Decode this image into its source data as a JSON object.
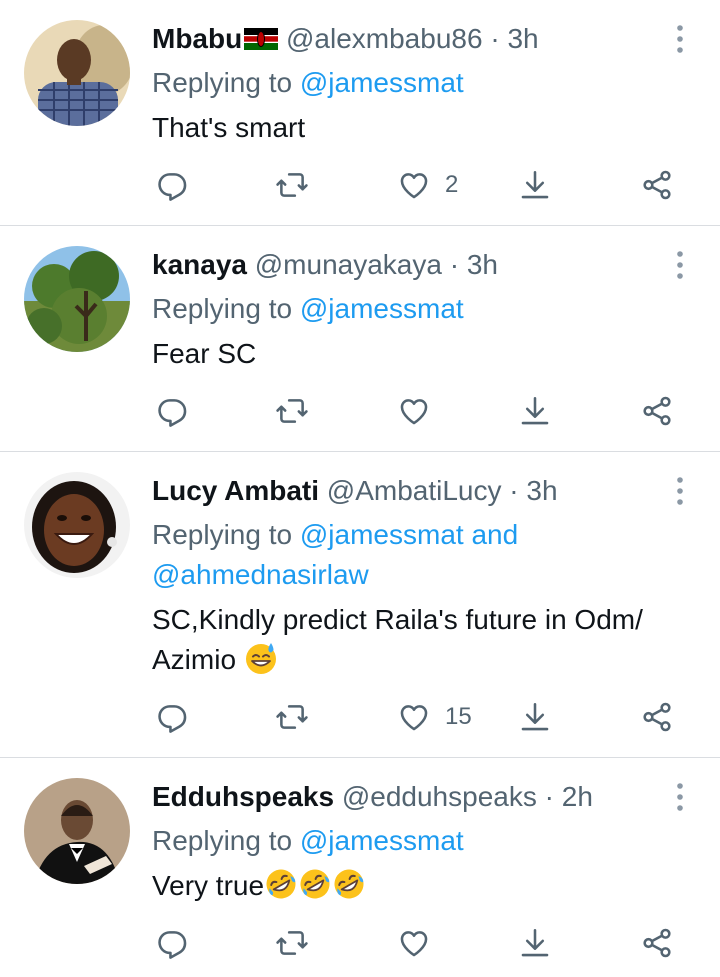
{
  "tweets": [
    {
      "name": "Mbabu",
      "handle": "@alexmbabu86",
      "separator": "·",
      "time": "3h",
      "replying_prefix": "Replying to",
      "replying_to": "@jamessmat",
      "text": "That's smart",
      "reply_count": "",
      "retweet_count": "",
      "like_count": "2"
    },
    {
      "name": "kanaya",
      "handle": "@munayakaya",
      "separator": "·",
      "time": "3h",
      "replying_prefix": "Replying to",
      "replying_to": "@jamessmat",
      "text": "Fear SC",
      "reply_count": "",
      "retweet_count": "",
      "like_count": ""
    },
    {
      "name": "Lucy Ambati",
      "handle": "@AmbatiLucy",
      "separator": "·",
      "time": "3h",
      "replying_prefix": "Replying to",
      "replying_to": "@jamessmat and",
      "replying_to_line2": "@ahmednasirlaw",
      "text_line1": "SC,Kindly predict Raila's future in Odm/",
      "text_line2": "Azimio",
      "reply_count": "",
      "retweet_count": "",
      "like_count": "15"
    },
    {
      "name": "Edduhspeaks",
      "handle": "@edduhspeaks",
      "separator": "·",
      "time": "2h",
      "replying_prefix": "Replying to",
      "replying_to": "@jamessmat",
      "text": "Very true",
      "reply_count": "",
      "retweet_count": "",
      "like_count": ""
    }
  ],
  "icons": {
    "reply": "reply-icon",
    "retweet": "retweet-icon",
    "like": "heart-icon",
    "download": "download-icon",
    "share": "share-icon",
    "more": "more-vertical-icon"
  },
  "colors": {
    "link": "#1d9bf0",
    "secondary": "#536471",
    "text": "#0f1419",
    "divider": "#dadde1"
  }
}
